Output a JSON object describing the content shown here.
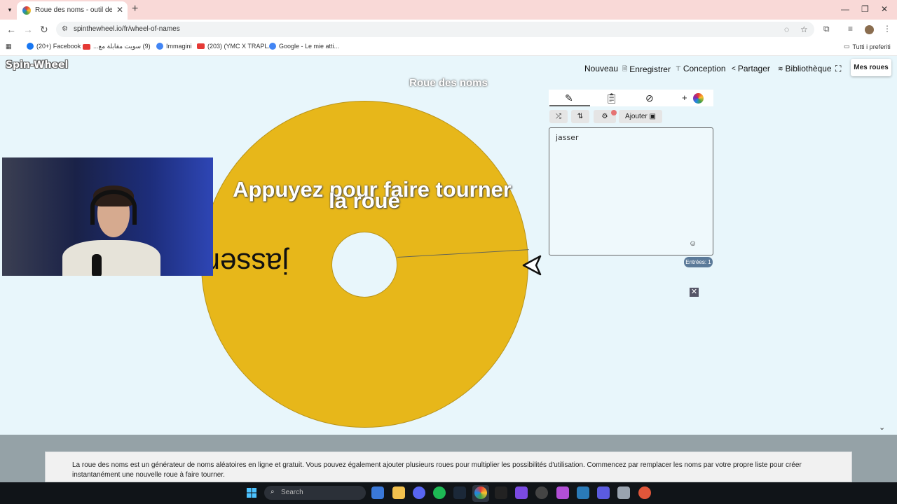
{
  "browser": {
    "tab_title": "Roue des noms - outil de sélection",
    "url": "spinthewheel.io/fr/wheel-of-names",
    "bookmarks": [
      {
        "label": "(20+) Facebook",
        "icon": "facebook-icon",
        "color": "#1877f2"
      },
      {
        "label": "(9) سويت مقابلة مع...",
        "icon": "youtube-icon",
        "color": "#e53935"
      },
      {
        "label": "Immagini",
        "icon": "google-icon",
        "color": "#4285f4"
      },
      {
        "label": "(203) (YMC X TRAPL...",
        "icon": "youtube-icon",
        "color": "#e53935"
      },
      {
        "label": "Google - Le mie atti...",
        "icon": "google-icon",
        "color": "#4285f4"
      }
    ],
    "all_bookmarks": "Tutti i preferiti"
  },
  "site": {
    "logo": "Spin-Wheel",
    "nav": [
      {
        "label": "Nouveau",
        "icon": ""
      },
      {
        "label": "Enregistrer",
        "icon": "save-icon"
      },
      {
        "label": "Conception",
        "icon": "paint-roller-icon"
      },
      {
        "label": "Partager",
        "icon": "share-icon"
      },
      {
        "label": "Bibliothèque",
        "icon": "layers-icon"
      }
    ],
    "my_wheels": "Mes roues"
  },
  "wheel": {
    "title": "Roue des noms",
    "hint_line1": "Appuyez pour faire tourner",
    "hint_line2": "la roue",
    "segment_label": "jasser",
    "segment_color": "#e7b71a"
  },
  "editor": {
    "add_image": "Ajouter",
    "entries_text": "jasser",
    "entries_count": "Entrées: 1"
  },
  "footer": {
    "text": "La roue des noms est un générateur de noms aléatoires en ligne et gratuit. Vous pouvez également ajouter plusieurs roues pour multiplier les possibilités d'utilisation. Commencez par remplacer les noms par votre propre liste pour créer instantanément une nouvelle roue à faire tourner."
  },
  "taskbar": {
    "search_placeholder": "Search"
  }
}
